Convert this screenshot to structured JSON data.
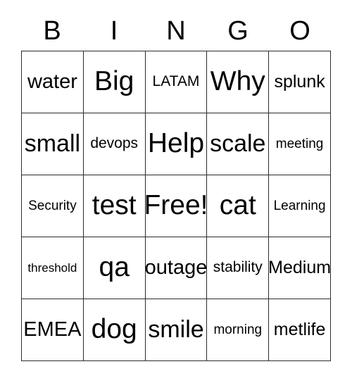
{
  "card": {
    "title": "BINGO",
    "header_letters": [
      "B",
      "I",
      "N",
      "G",
      "O"
    ],
    "rows": [
      [
        {
          "label": "water",
          "size": "l"
        },
        {
          "label": "Big",
          "size": "xxl"
        },
        {
          "label": "LATAM",
          "size": "s"
        },
        {
          "label": "Why",
          "size": "xxl"
        },
        {
          "label": "splunk",
          "size": "m"
        }
      ],
      [
        {
          "label": "small",
          "size": "xl"
        },
        {
          "label": "devops",
          "size": "s"
        },
        {
          "label": "Help",
          "size": "xxl"
        },
        {
          "label": "scale",
          "size": "xl"
        },
        {
          "label": "meeting",
          "size": "xs"
        }
      ],
      [
        {
          "label": "Security",
          "size": "xs"
        },
        {
          "label": "test",
          "size": "xxl"
        },
        {
          "label": "Free!",
          "size": "xxl"
        },
        {
          "label": "cat",
          "size": "xxl"
        },
        {
          "label": "Learning",
          "size": "xs"
        }
      ],
      [
        {
          "label": "threshold",
          "size": "xxs"
        },
        {
          "label": "qa",
          "size": "xxl"
        },
        {
          "label": "outage",
          "size": "l"
        },
        {
          "label": "stability",
          "size": "s"
        },
        {
          "label": "Medium",
          "size": "m"
        }
      ],
      [
        {
          "label": "EMEA",
          "size": "l"
        },
        {
          "label": "dog",
          "size": "xxl"
        },
        {
          "label": "smile",
          "size": "xl"
        },
        {
          "label": "morning",
          "size": "xs"
        },
        {
          "label": "metlife",
          "size": "m"
        }
      ]
    ],
    "free_space": "Free!",
    "colors": {
      "background": "#ffffff",
      "text": "#000000",
      "grid_line": "#2b2b2b"
    }
  }
}
